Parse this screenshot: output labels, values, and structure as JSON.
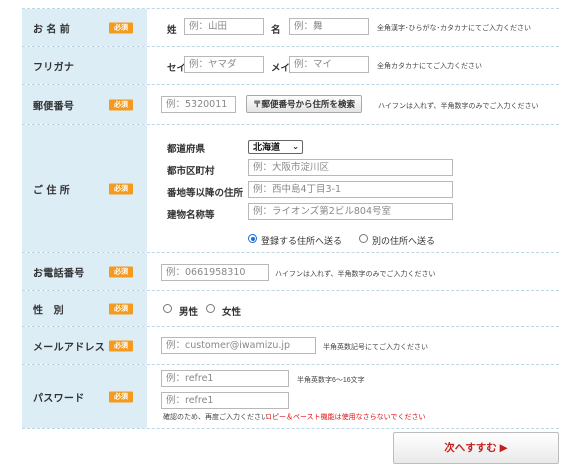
{
  "badge": "必須",
  "name": {
    "label": "お 名 前",
    "sei_label": "姓",
    "sei_placeholder": "例：山田",
    "mei_label": "名",
    "mei_placeholder": "例：舞",
    "note": "全角漢字･ひらがな･カタカナにてご入力ください"
  },
  "kana": {
    "label": "フリガナ",
    "sei_label": "セイ",
    "sei_placeholder": "例：ヤマダ",
    "mei_label": "メイ",
    "mei_placeholder": "例：マイ",
    "note": "全角カタカナにてご入力ください"
  },
  "zip": {
    "label": "郵便番号",
    "placeholder": "例：5320011",
    "search_button": "〒郵便番号から住所を検索",
    "note": "ハイフンは入れず、半角数字のみでご入力ください"
  },
  "address": {
    "label": "ご 住 所",
    "pref_label": "都道府県",
    "pref_value": "北海道",
    "city_label": "都市区町村",
    "city_placeholder": "例：大阪市淀川区",
    "street_label": "番地等以降の住所",
    "street_placeholder": "例：西中島4丁目3-1",
    "building_label": "建物名称等",
    "building_placeholder": "例：ライオンズ第2ビル804号室",
    "radio_registered": "登録する住所へ送る",
    "radio_other": "別の住所へ送る"
  },
  "phone": {
    "label": "お電話番号",
    "placeholder": "例：0661958310",
    "note": "ハイフンは入れず、半角数字のみでご入力ください"
  },
  "gender": {
    "label": "性　別",
    "male": "男性",
    "female": "女性"
  },
  "email": {
    "label": "メールアドレス",
    "placeholder": "例：customer@iwamizu.jp",
    "note": "半角英数記号にてご入力ください"
  },
  "password": {
    "label": "パスワード",
    "placeholder": "例：refre1",
    "confirm_placeholder": "例：refre1",
    "note": "半角英数字6〜16文字",
    "confirm_note": "確認のため、再度ご入力ください",
    "warning": "コピー＆ペースト機能は使用なさらないでください"
  },
  "next_button": "次へすすむ ▶"
}
